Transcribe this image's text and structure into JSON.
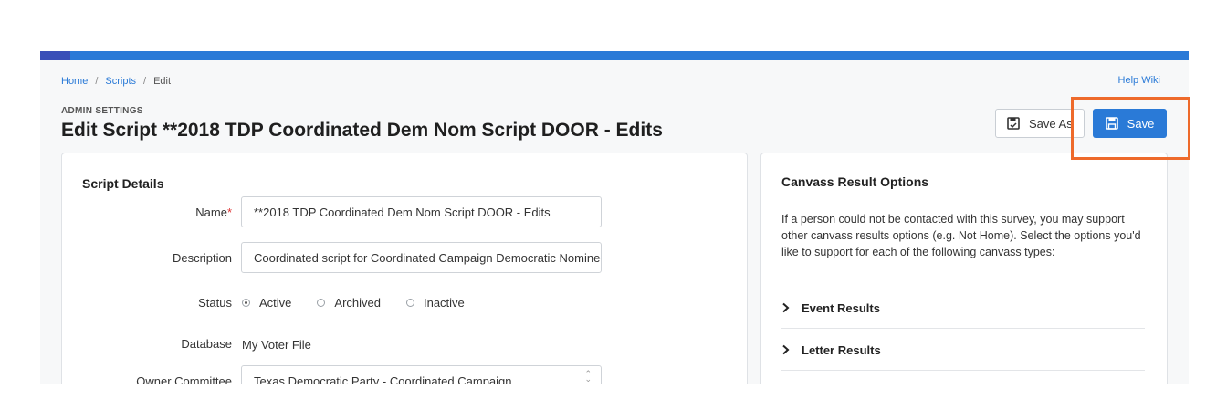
{
  "breadcrumb": {
    "home": "Home",
    "scripts": "Scripts",
    "current": "Edit",
    "separator": "/"
  },
  "help_link": "Help Wiki",
  "header": {
    "eyebrow": "ADMIN SETTINGS",
    "title": "Edit Script **2018 TDP Coordinated Dem Nom Script DOOR - Edits"
  },
  "toolbar": {
    "save_as_label": "Save As",
    "save_label": "Save"
  },
  "colors": {
    "primary": "#2a7ad7",
    "highlight": "#ee6a2b",
    "required": "#d33333"
  },
  "script_details": {
    "title": "Script Details",
    "name_label": "Name",
    "required_marker": "*",
    "name_value": "**2018 TDP Coordinated Dem Nom Script DOOR - Edits",
    "description_label": "Description",
    "description_value": "Coordinated script for Coordinated Campaign Democratic Nominee",
    "status_label": "Status",
    "status_options": [
      "Active",
      "Archived",
      "Inactive"
    ],
    "status_selected": "Active",
    "database_label": "Database",
    "database_value": "My Voter File",
    "owner_label": "Owner Committee",
    "owner_value": "Texas Democratic Party - Coordinated Campaign"
  },
  "canvass": {
    "title": "Canvass Result Options",
    "description": "If a person could not be contacted with this survey, you may support other canvass results options (e.g. Not Home). Select the options you'd like to support for each of the following canvass types:",
    "sections": [
      "Event Results",
      "Letter Results"
    ]
  }
}
